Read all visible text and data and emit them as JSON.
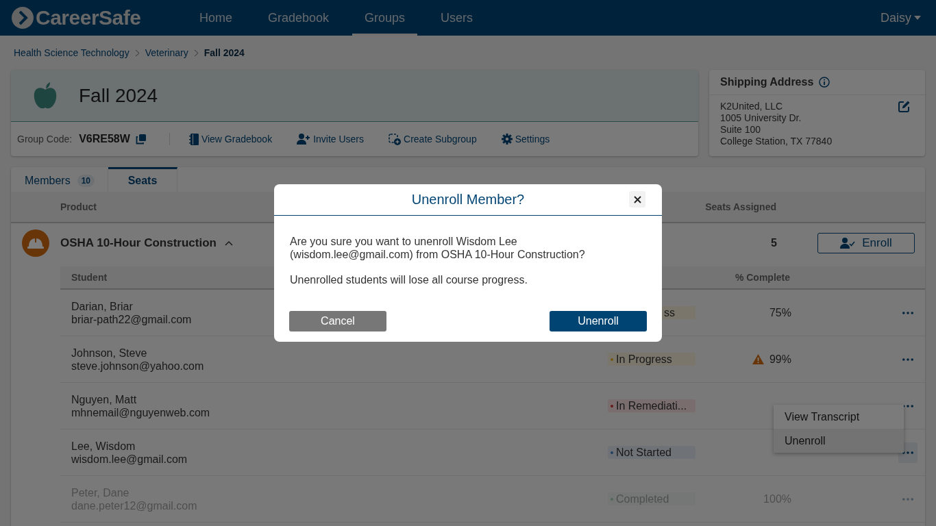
{
  "nav": {
    "logo": "CareerSafe",
    "items": [
      {
        "label": "Home",
        "selected": false
      },
      {
        "label": "Gradebook",
        "selected": false
      },
      {
        "label": "Groups",
        "selected": true
      },
      {
        "label": "Users",
        "selected": false
      }
    ],
    "user": "Daisy"
  },
  "breadcrumb": [
    {
      "label": "Health Science Technology",
      "current": false
    },
    {
      "label": "Veterinary",
      "current": false
    },
    {
      "label": "Fall 2024",
      "current": true
    }
  ],
  "group": {
    "title": "Fall 2024",
    "code_label": "Group Code:",
    "code": "V6RE58W",
    "actions": [
      {
        "kind": "gradebook",
        "label": "View Gradebook"
      },
      {
        "kind": "invite",
        "label": "Invite Users"
      },
      {
        "kind": "subgroup",
        "label": "Create Subgroup"
      },
      {
        "kind": "settings",
        "label": "Settings"
      }
    ]
  },
  "shipping": {
    "title": "Shipping Address",
    "lines": [
      "K2United, LLC",
      "1005 University Dr.",
      "Suite 100",
      "College Station, TX 77840"
    ]
  },
  "tabs": [
    {
      "label": "Members",
      "count": "10",
      "selected": false
    },
    {
      "label": "Seats",
      "selected": true
    }
  ],
  "products": {
    "columns": [
      "Product",
      "Seats Assigned"
    ],
    "rows": [
      {
        "name": "OSHA 10-Hour Construction",
        "expanded": true,
        "seats": "5",
        "action": "Enroll",
        "student_columns": [
          "Student",
          "% Complete"
        ],
        "students": [
          {
            "name": "Darian, Briar",
            "email": "briar-path22@gmail.com",
            "status": "ss",
            "kind": "in_progress",
            "hidden_left": true,
            "complete": "75%",
            "warning": false,
            "menu_open": false,
            "faded": false
          },
          {
            "name": "Johnson, Steve",
            "email": "steve.johnson@yahoo.com",
            "status": "In Progress",
            "kind": "in_progress",
            "hidden_left": false,
            "complete": "99%",
            "warning": true,
            "menu_open": false,
            "faded": false
          },
          {
            "name": "Nguyen, Matt",
            "email": "mhnemail@nguyenweb.com",
            "status": "In Remediati...",
            "kind": "remediation",
            "hidden_left": false,
            "warning": false,
            "menu_open": false,
            "faded": false
          },
          {
            "name": "Lee, Wisdom",
            "email": "wisdom.lee@gmail.com",
            "status": "Not Started",
            "kind": "not_started",
            "hidden_left": false,
            "warning": false,
            "menu_open": true,
            "faded": false
          },
          {
            "name": "Peter, Dane",
            "email": "dane.peter12@gmail.com",
            "status": "Completed",
            "kind": "completed",
            "hidden_left": false,
            "complete": "100%",
            "warning": false,
            "menu_open": false,
            "faded": true
          }
        ]
      }
    ]
  },
  "row_menu": [
    {
      "label": "View Transcript",
      "selected": false
    },
    {
      "label": "Unenroll",
      "selected": true
    }
  ],
  "modal": {
    "title": "Unenroll Member?",
    "paragraphs": [
      "Are you sure you want to unenroll Wisdom Lee (wisdom.lee@gmail.com) from OSHA 10-Hour Construction?",
      "Unenrolled students will lose all course progress."
    ],
    "buttons": [
      {
        "label": "Cancel",
        "kind": "secondary"
      },
      {
        "label": "Unenroll",
        "kind": "primary"
      }
    ]
  }
}
